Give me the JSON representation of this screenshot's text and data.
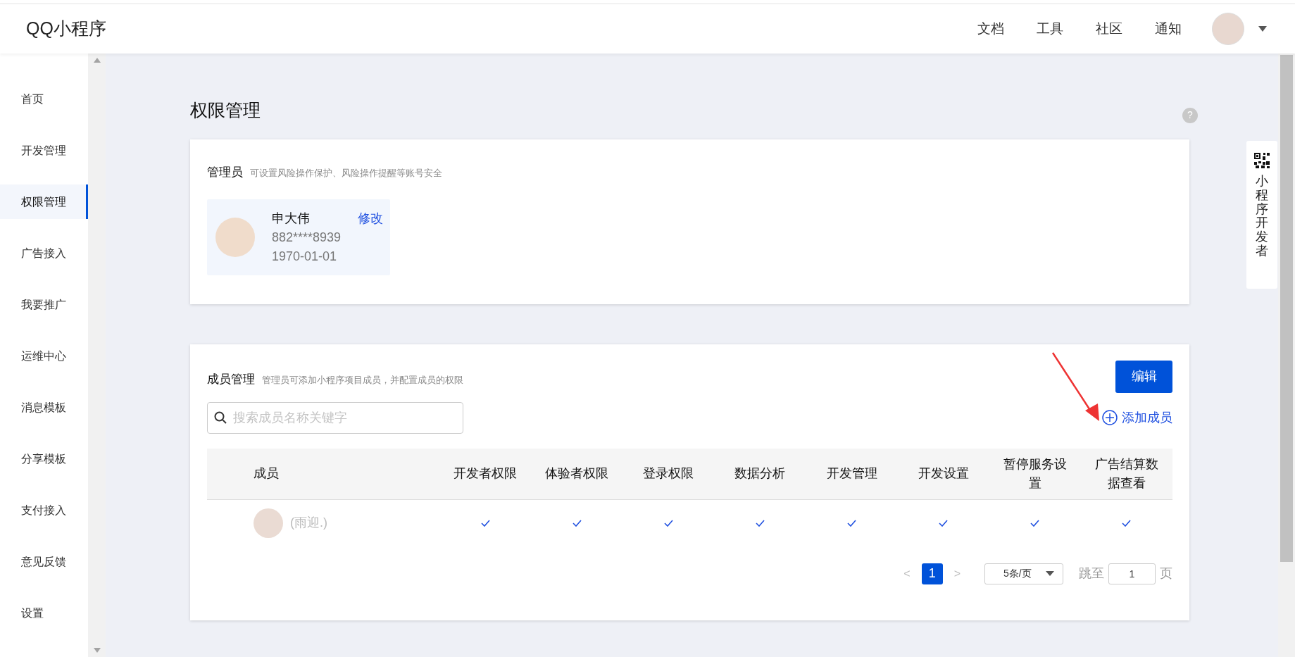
{
  "header": {
    "logo": "QQ小程序",
    "nav": [
      "文档",
      "工具",
      "社区",
      "通知"
    ]
  },
  "sidebar": {
    "items": [
      {
        "label": "首页",
        "selected": false
      },
      {
        "label": "开发管理",
        "selected": false
      },
      {
        "label": "权限管理",
        "selected": true
      },
      {
        "label": "广告接入",
        "selected": false
      },
      {
        "label": "我要推广",
        "selected": false
      },
      {
        "label": "运维中心",
        "selected": false
      },
      {
        "label": "消息模板",
        "selected": false
      },
      {
        "label": "分享模板",
        "selected": false
      },
      {
        "label": "支付接入",
        "selected": false
      },
      {
        "label": "意见反馈",
        "selected": false
      },
      {
        "label": "设置",
        "selected": false
      }
    ]
  },
  "page_title": "权限管理",
  "help": "?",
  "admin": {
    "title": "管理员",
    "hint": "可设置风险操作保护、风险操作提醒等账号安全",
    "name": "申大伟",
    "phone": "882****8939",
    "date": "1970-01-01",
    "edit": "修改"
  },
  "members": {
    "title": "成员管理",
    "hint": "管理员可添加小程序项目成员，并配置成员的权限",
    "edit_button": "编辑",
    "add": "添加成员",
    "search": {
      "placeholder": "搜索成员名称关键字"
    },
    "table": {
      "columns": [
        "成员",
        "开发者权限",
        "体验者权限",
        "登录权限",
        "数据分析",
        "开发管理",
        "开发设置",
        "暂停服务设置",
        "广告结算数据查看"
      ],
      "rows": [
        {
          "name": "(雨迎.)",
          "permissions": [
            {
              "checked": true
            },
            {
              "checked": true
            },
            {
              "checked": true
            },
            {
              "checked": true
            },
            {
              "checked": true
            },
            {
              "checked": true
            },
            {
              "checked": true
            },
            {
              "checked": true
            }
          ]
        }
      ]
    },
    "pagination": {
      "prev": "<",
      "pages": [
        {
          "label": "1",
          "selected": true
        }
      ],
      "next": ">",
      "page_size": "5条/页",
      "jump_label": "跳至",
      "jump_value": "1",
      "page_unit": "页"
    }
  },
  "side_tab": {
    "label": "小程序开发者"
  }
}
